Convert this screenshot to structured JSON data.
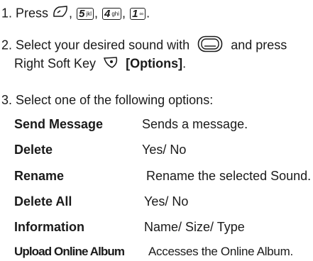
{
  "step1": {
    "text": "1. Press",
    "keys": [
      {
        "num": "5",
        "sub": "jkl"
      },
      {
        "num": "4",
        "sub": "ghi"
      },
      {
        "num": "1",
        "sub": "∞"
      }
    ],
    "icon": "send-key-icon",
    "end": "."
  },
  "step2": {
    "line1a": "2. Select your desired sound with",
    "line1b": "and press",
    "nav_icon": "navigation-key-icon",
    "line2a": "Right Soft Key",
    "soft_icon": "right-soft-key-icon",
    "options_label": "[Options]",
    "end": "."
  },
  "step3": {
    "text": "3. Select one of the following options:"
  },
  "options": [
    {
      "label": "Send Message",
      "desc": "Sends a message."
    },
    {
      "label": "Delete",
      "desc": "Yes/ No"
    },
    {
      "label": "Rename",
      "desc": "Rename the selected Sound."
    },
    {
      "label": "Delete All",
      "desc": "Yes/ No"
    },
    {
      "label": "Information",
      "desc": "Name/ Size/ Type"
    },
    {
      "label": "Upload Online Album",
      "desc": "Accesses the Online Album."
    }
  ]
}
